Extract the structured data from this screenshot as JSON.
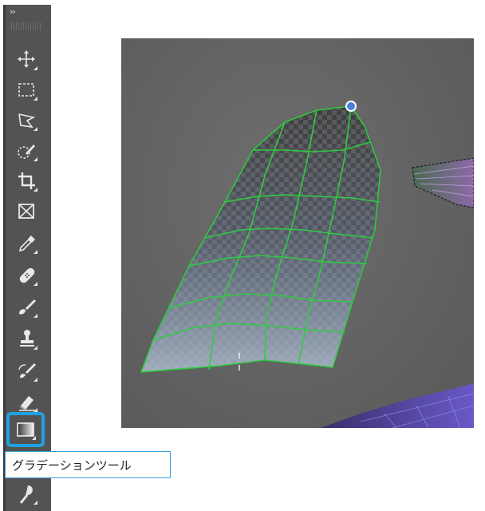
{
  "toolbar": {
    "collapse_glyph": "››",
    "tools": [
      {
        "name": "move-tool",
        "icon": "move-icon"
      },
      {
        "name": "marquee-tool",
        "icon": "rectangular-marquee-icon"
      },
      {
        "name": "lasso-tool",
        "icon": "polygonal-lasso-icon"
      },
      {
        "name": "quick-selection-tool",
        "icon": "quick-selection-icon"
      },
      {
        "name": "crop-tool",
        "icon": "crop-icon"
      },
      {
        "name": "frame-tool",
        "icon": "frame-icon"
      },
      {
        "name": "eyedropper-tool",
        "icon": "eyedropper-icon"
      },
      {
        "name": "healing-brush-tool",
        "icon": "bandage-icon"
      },
      {
        "name": "brush-tool",
        "icon": "brush-icon"
      },
      {
        "name": "clone-stamp-tool",
        "icon": "stamp-icon"
      },
      {
        "name": "history-brush-tool",
        "icon": "history-brush-icon"
      },
      {
        "name": "eraser-tool",
        "icon": "eraser-icon"
      },
      {
        "name": "gradient-tool",
        "icon": "gradient-icon",
        "active": true
      },
      {
        "name": "blur-tool",
        "icon": "blur-icon"
      }
    ]
  },
  "tooltip": {
    "text": "グラデーションツール"
  },
  "colors": {
    "accent": "#1ea2e0",
    "toolbar_bg": "#535353",
    "mesh_green": "#2ecc40",
    "handle_blue": "#4a7fe0"
  }
}
